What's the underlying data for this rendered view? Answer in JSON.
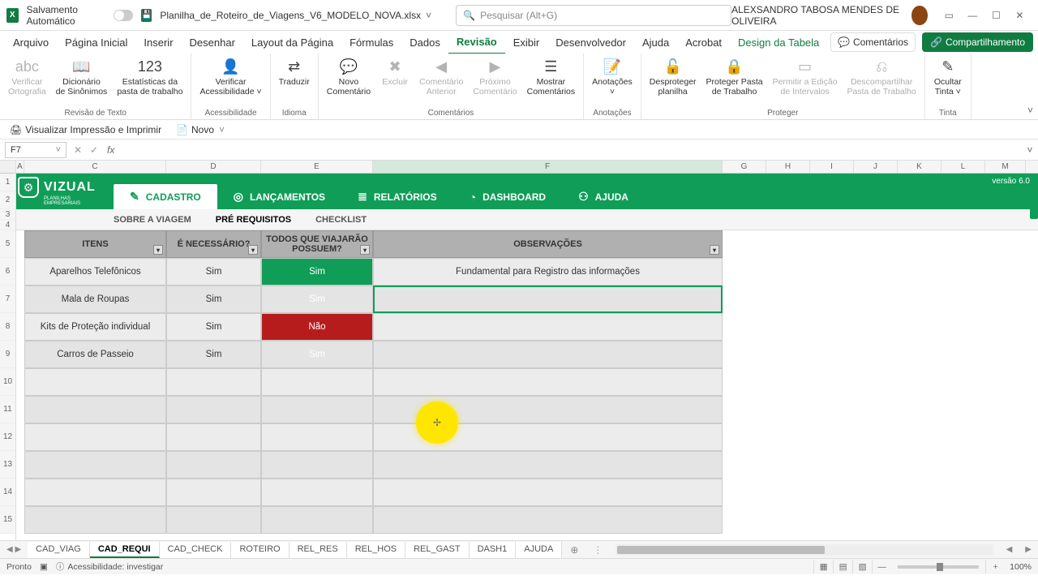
{
  "titlebar": {
    "autosave": "Salvamento Automático",
    "filename": "Planilha_de_Roteiro_de_Viagens_V6_MODELO_NOVA.xlsx",
    "search_placeholder": "Pesquisar (Alt+G)",
    "user": "ALEXSANDRO TABOSA MENDES DE OLIVEIRA"
  },
  "ribbon_tabs": {
    "items": [
      "Arquivo",
      "Página Inicial",
      "Inserir",
      "Desenhar",
      "Layout da Página",
      "Fórmulas",
      "Dados",
      "Revisão",
      "Exibir",
      "Desenvolvedor",
      "Ajuda",
      "Acrobat",
      "Design da Tabela"
    ],
    "active_index": 7,
    "comments": "Comentários",
    "share": "Compartilhamento"
  },
  "ribbon": {
    "groups": [
      {
        "label": "Revisão de Texto",
        "buttons": [
          {
            "text": "Verificar\nOrtografia",
            "icon": "abc",
            "disabled": true
          },
          {
            "text": "Dicionário\nde Sinônimos",
            "icon": "📖"
          },
          {
            "text": "Estatísticas da\npasta de trabalho",
            "icon": "123"
          }
        ]
      },
      {
        "label": "Acessibilidade",
        "buttons": [
          {
            "text": "Verificar\nAcessibilidade ˅",
            "icon": "👤"
          }
        ]
      },
      {
        "label": "Idioma",
        "buttons": [
          {
            "text": "Traduzir",
            "icon": "⇄"
          }
        ]
      },
      {
        "label": "Comentários",
        "buttons": [
          {
            "text": "Novo\nComentário",
            "icon": "💬"
          },
          {
            "text": "Excluir",
            "icon": "✖",
            "disabled": true
          },
          {
            "text": "Comentário\nAnterior",
            "icon": "◀",
            "disabled": true
          },
          {
            "text": "Próximo\nComentário",
            "icon": "▶",
            "disabled": true
          },
          {
            "text": "Mostrar\nComentários",
            "icon": "☰"
          }
        ]
      },
      {
        "label": "Anotações",
        "buttons": [
          {
            "text": "Anotações\n˅",
            "icon": "📝"
          }
        ]
      },
      {
        "label": "Proteger",
        "buttons": [
          {
            "text": "Desproteger\nplanilha",
            "icon": "🔓"
          },
          {
            "text": "Proteger Pasta\nde Trabalho",
            "icon": "🔒"
          },
          {
            "text": "Permitir a Edição\nde Intervalos",
            "icon": "▭",
            "disabled": true
          },
          {
            "text": "Descompartilhar\nPasta de Trabalho",
            "icon": "⎌",
            "disabled": true
          }
        ]
      },
      {
        "label": "Tinta",
        "buttons": [
          {
            "text": "Ocultar\nTinta ˅",
            "icon": "✎"
          }
        ]
      }
    ]
  },
  "qat": {
    "print_preview": "Visualizar Impressão e Imprimir",
    "new": "Novo"
  },
  "formula_bar": {
    "name_box": "F7",
    "formula": ""
  },
  "columns": [
    "A",
    "C",
    "D",
    "E",
    "F",
    "G",
    "H",
    "I",
    "J",
    "K",
    "L",
    "M"
  ],
  "selected_col": "F",
  "rows": [
    "1",
    "2",
    "3",
    "4",
    "5",
    "6",
    "7",
    "8",
    "9",
    "10",
    "11",
    "12",
    "13",
    "14",
    "15"
  ],
  "vizual": {
    "brand": "VIZUAL",
    "sub": "PLANILHAS EMPRESARIAIS",
    "version": "versão 6.0",
    "tabs": [
      {
        "label": "CADASTRO",
        "icon": "✎",
        "active": true
      },
      {
        "label": "LANÇAMENTOS",
        "icon": "◎"
      },
      {
        "label": "RELATÓRIOS",
        "icon": "≣"
      },
      {
        "label": "DASHBOARD",
        "icon": "◔"
      },
      {
        "label": "AJUDA",
        "icon": "⚇"
      }
    ]
  },
  "sub_tabs": {
    "items": [
      "SOBRE A VIAGEM",
      "PRÉ REQUISITOS",
      "CHECKLIST"
    ],
    "active_index": 1
  },
  "table": {
    "headers": [
      "ITENS",
      "É NECESSÁRIO?",
      "TODOS QUE VIAJARÃO POSSUEM?",
      "OBSERVAÇÕES"
    ],
    "rows": [
      {
        "item": "Aparelhos Telefônicos",
        "nec": "Sim",
        "pos": "Sim",
        "pos_cls": "sim",
        "obs": "Fundamental para Registro das informações"
      },
      {
        "item": "Mala de Roupas",
        "nec": "Sim",
        "pos": "Sim",
        "pos_cls": "sim",
        "obs": "",
        "selected": true
      },
      {
        "item": "Kits de Proteção individual",
        "nec": "Sim",
        "pos": "Não",
        "pos_cls": "nao",
        "obs": ""
      },
      {
        "item": "Carros de Passeio",
        "nec": "Sim",
        "pos": "Sim",
        "pos_cls": "sim",
        "obs": ""
      }
    ],
    "empty_rows": 6
  },
  "sheet_tabs": {
    "items": [
      "CAD_VIAG",
      "CAD_REQUI",
      "CAD_CHECK",
      "ROTEIRO",
      "REL_RES",
      "REL_HOS",
      "REL_GAST",
      "DASH1",
      "AJUDA"
    ],
    "active_index": 1
  },
  "status_bar": {
    "ready": "Pronto",
    "accessibility": "Acessibilidade: investigar",
    "zoom": "100%"
  }
}
